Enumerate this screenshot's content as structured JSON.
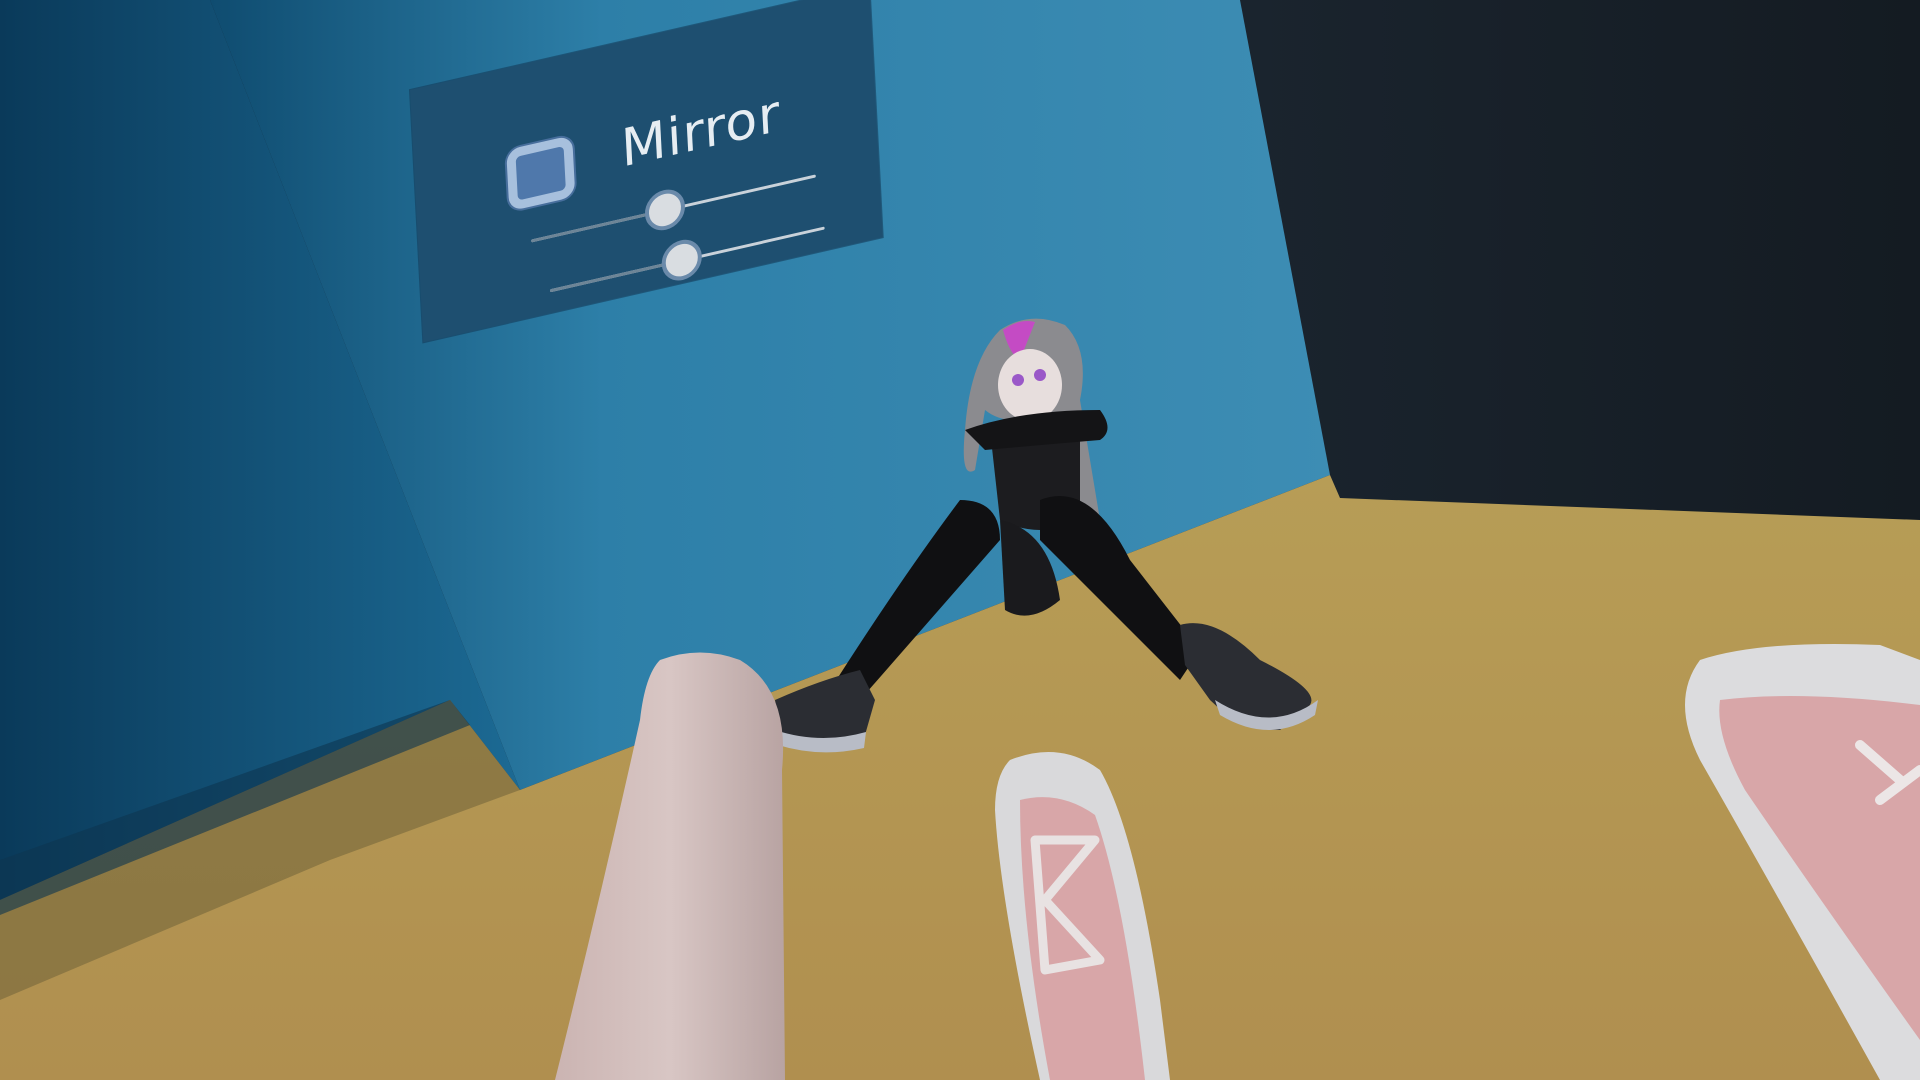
{
  "mirror_panel": {
    "label": "Mirror",
    "checkbox_checked": false,
    "sliders": [
      {
        "name": "slider-1",
        "value": 0.47
      },
      {
        "name": "slider-2",
        "value": 0.48
      }
    ]
  },
  "colors": {
    "wall_left": "#3e8db4",
    "wall_dark": "#1a242d",
    "floor": "#b49a55",
    "panel": "#1e4f70",
    "checkbox_fill": "#4f78ab",
    "checkbox_border": "#a7c0dd",
    "label_text": "#e6edf2",
    "shoe_pink": "#d8a6a8"
  }
}
